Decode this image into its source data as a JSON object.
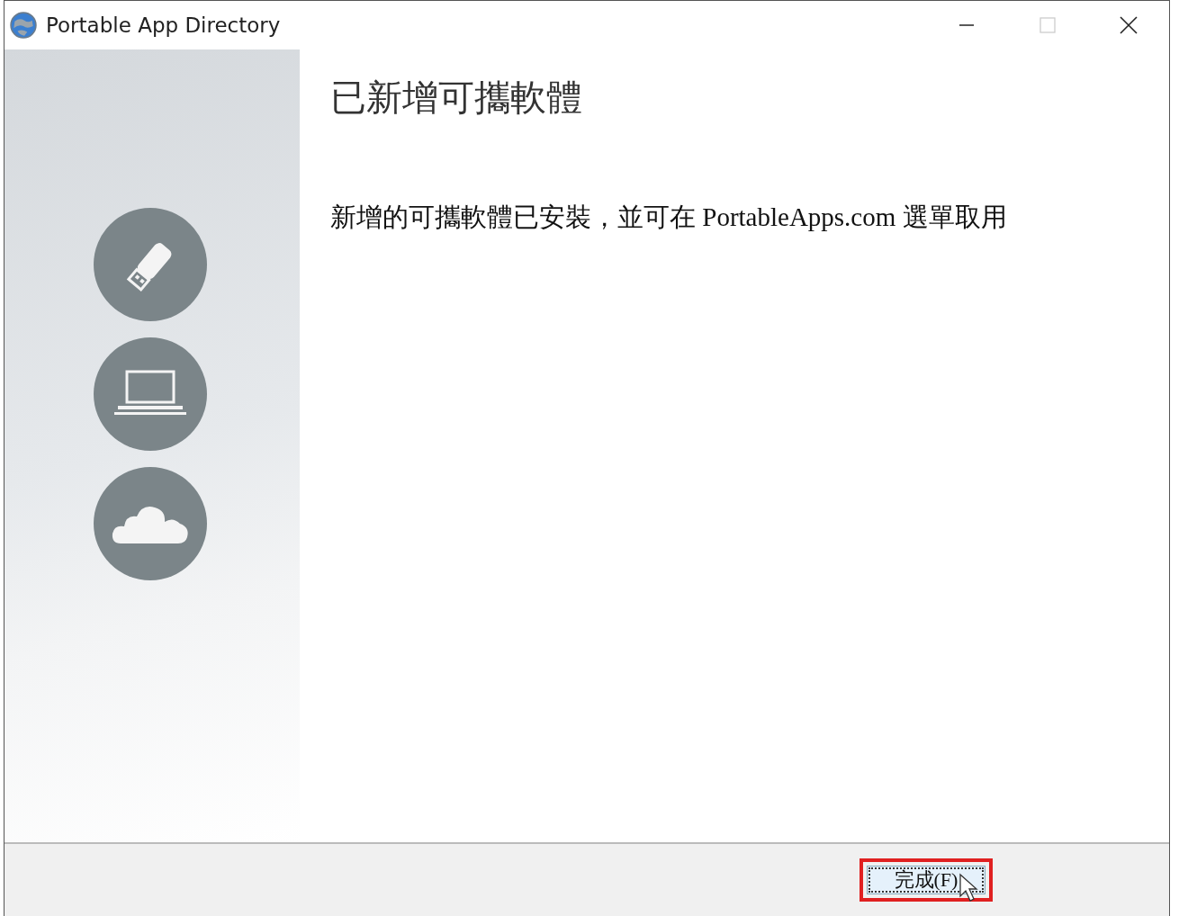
{
  "window": {
    "title": "Portable App Directory",
    "maximize_disabled": true
  },
  "heading": "已新增可攜軟體",
  "message": "新增的可攜軟體已安裝，並可在 PortableApps.com 選單取用",
  "sidebar_icons": [
    {
      "kind": "usb"
    },
    {
      "kind": "laptop"
    },
    {
      "kind": "cloud"
    }
  ],
  "footer": {
    "button": {
      "label": "完成(F)",
      "focused": true,
      "highlighted": true
    }
  }
}
